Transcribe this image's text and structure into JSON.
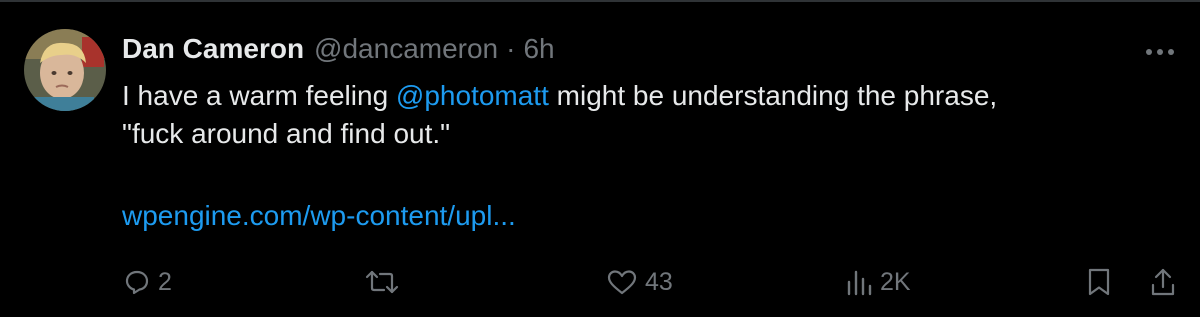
{
  "tweet": {
    "author_name": "Dan Cameron",
    "author_handle": "@dancameron",
    "separator": "·",
    "time": "6h",
    "text_before_mention": "I have a warm feeling ",
    "mention": "@photomatt",
    "text_after_mention": " might be understanding the phrase,",
    "text_line2": "\"fuck around and find out.\"",
    "link": "wpengine.com/wp-content/upl..."
  },
  "actions": {
    "replies": "2",
    "retweets": "",
    "likes": "43",
    "views": "2K"
  },
  "icons": {
    "more": "more-horizontal-icon",
    "reply": "reply-icon",
    "retweet": "retweet-icon",
    "like": "heart-icon",
    "views": "analytics-icon",
    "bookmark": "bookmark-icon",
    "share": "share-icon"
  },
  "colors": {
    "background": "#000000",
    "text": "#e7e9ea",
    "muted": "#71767b",
    "accent": "#1d9bf0"
  }
}
